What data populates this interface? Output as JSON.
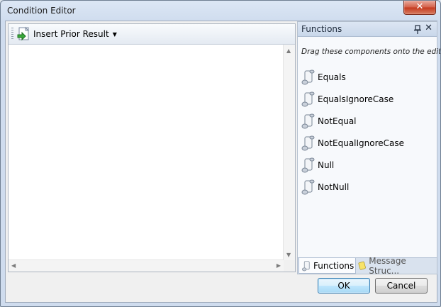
{
  "window": {
    "title": "Condition Editor",
    "close_glyph": "✕"
  },
  "toolbar": {
    "insert_label": "Insert Prior Result",
    "insert_caret": "▼"
  },
  "functions_panel": {
    "title": "Functions",
    "pin_glyph": "📌",
    "close_glyph": "✕",
    "hint": "Drag these components onto the editor",
    "items": [
      {
        "label": "Equals"
      },
      {
        "label": "EqualsIgnoreCase"
      },
      {
        "label": "NotEqual"
      },
      {
        "label": "NotEqualIgnoreCase"
      },
      {
        "label": "Null"
      },
      {
        "label": "NotNull"
      }
    ],
    "tabs": [
      {
        "label": "Functions"
      },
      {
        "label": "Message Struc..."
      }
    ]
  },
  "buttons": {
    "ok": "OK",
    "cancel": "Cancel"
  },
  "scrollbar": {
    "up": "▲",
    "down": "▼",
    "left": "◀",
    "right": "▶"
  }
}
